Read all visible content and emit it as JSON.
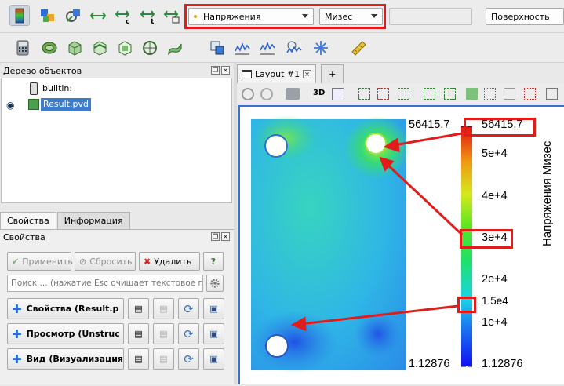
{
  "toolbar_top": {
    "variable_combo": "Напряжения",
    "component_combo": "Мизес",
    "representation_combo": "Поверхность",
    "icons": [
      "color-map-editor-icon",
      "color-legend-icon",
      "rescale-custom-icon",
      "rescale-range-icon",
      "rescale-c-icon",
      "rescale-t-icon",
      "rescale-visible-icon"
    ]
  },
  "toolbar_second": {
    "icons": [
      "calculator-icon",
      "contour-icon",
      "clip-icon",
      "slice-icon",
      "threshold-icon",
      "extract-icon",
      "glyph-icon",
      "stream-tracer-icon",
      "warp-icon",
      "group-icon",
      "extract-level-icon",
      "plot-over-line-icon",
      "histogram-icon",
      "probe-icon",
      "ruler-icon"
    ]
  },
  "pipeline": {
    "title": "Дерево объектов",
    "items": [
      {
        "label": "builtin:",
        "icon": "server-icon"
      },
      {
        "label": "Result.pvd",
        "icon": "dataset-icon",
        "selected": true
      }
    ]
  },
  "tabs": {
    "properties": "Свойства",
    "information": "Информация"
  },
  "properties": {
    "title": "Свойства",
    "apply": "Применить",
    "reset": "Сбросить",
    "delete": "Удалить",
    "help": "?",
    "search_placeholder": "Поиск ... (нажатие Esc очищает текстовое по...",
    "sections": [
      "Свойства (Result.p",
      "Просмотр (Unstruc",
      "Вид (Визуализация"
    ]
  },
  "layout": {
    "tab_label": "Layout #1",
    "add_tab": "+",
    "view_3d": "3D"
  },
  "colorbar": {
    "title": "Напряжения Мизес",
    "range_max": "56415.7",
    "range_min": "1.12876",
    "labels": [
      {
        "text": "56415.7",
        "value": 56415.7,
        "highlighted": true
      },
      {
        "text": "5e+4",
        "value": 50000
      },
      {
        "text": "4e+4",
        "value": 40000
      },
      {
        "text": "3e+4",
        "value": 30000,
        "highlighted": true
      },
      {
        "text": "2e+4",
        "value": 20000
      },
      {
        "text": "1.5e4",
        "value": 15000,
        "highlighted": true
      },
      {
        "text": "1e+4",
        "value": 10000
      },
      {
        "text": "1.12876",
        "value": 1.12876
      }
    ]
  },
  "colors": {
    "annotation": "#e21b1b",
    "selection": "#3d7cc9",
    "view_border": "#3c6fd0"
  }
}
